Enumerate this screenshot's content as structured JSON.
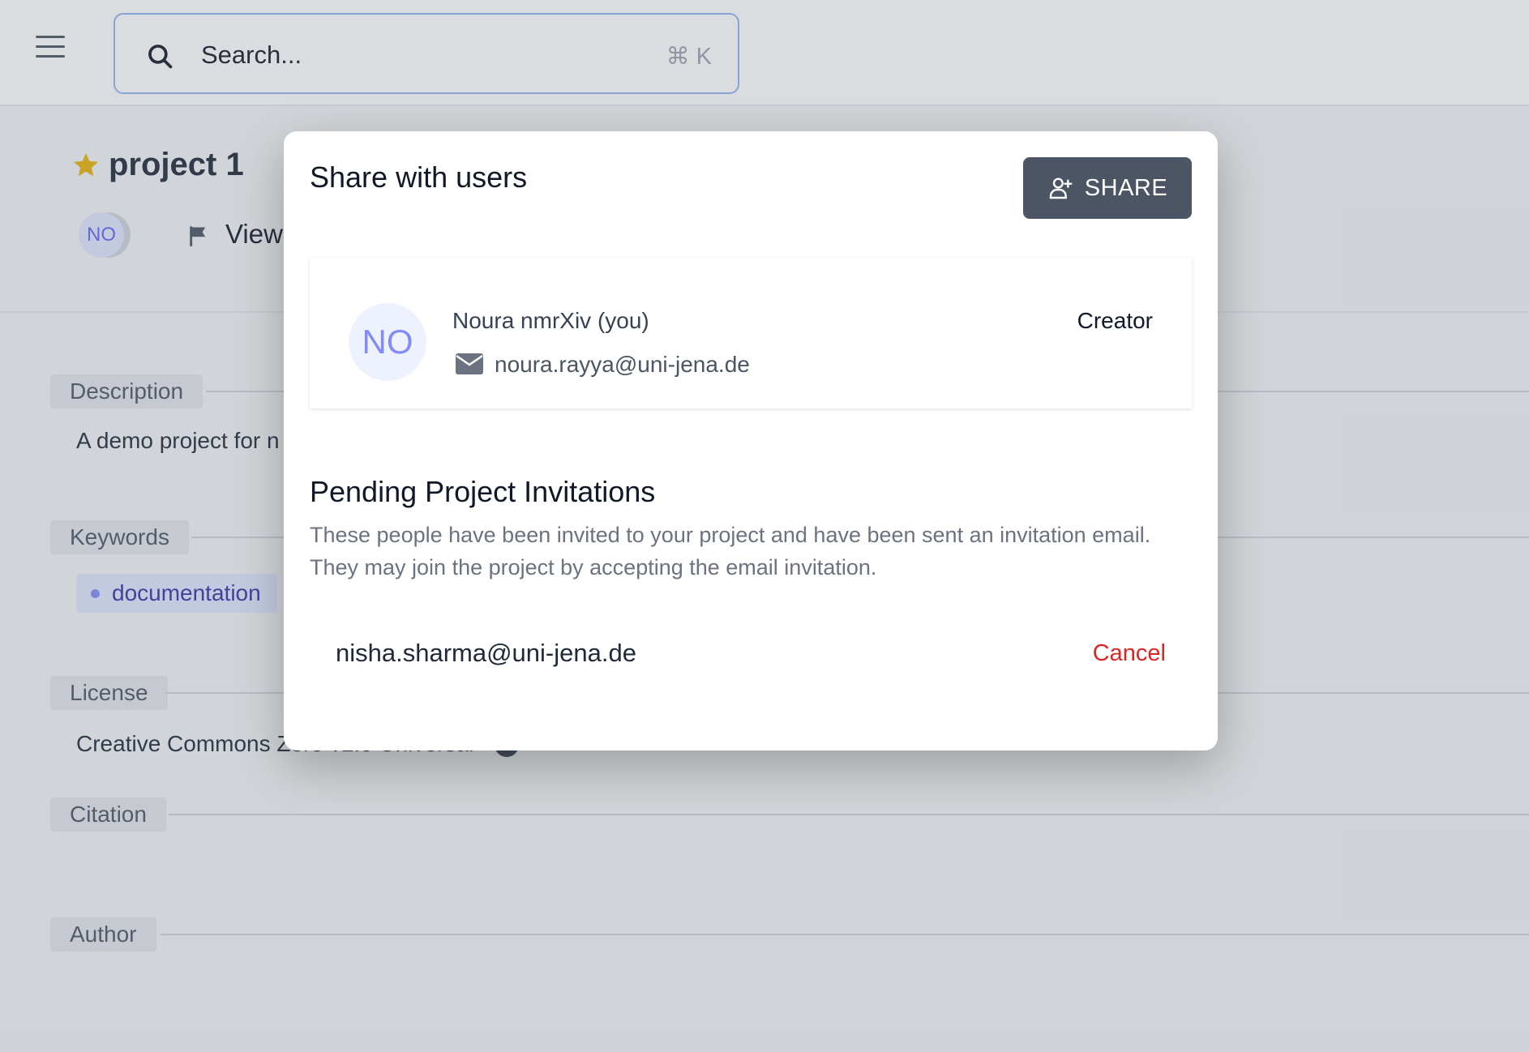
{
  "header": {
    "search_placeholder": "Search...",
    "search_shortcut": "⌘ K",
    "menu_icon": "hamburger-menu-icon",
    "search_icon": "search-icon"
  },
  "project": {
    "title": "project 1",
    "avatar_initials": "NO",
    "view_label": "View",
    "sections": {
      "description_label": "Description",
      "description_text": "A demo project for n",
      "keywords_label": "Keywords",
      "keyword": "documentation",
      "license_label": "License",
      "license_text": "Creative Commons Zero v1.0 Universal",
      "citation_label": "Citation",
      "author_label": "Author"
    }
  },
  "modal": {
    "title": "Share with users",
    "share_button": "SHARE",
    "user": {
      "initials": "NO",
      "name": "Noura nmrXiv (you)",
      "email": "noura.rayya@uni-jena.de",
      "role": "Creator"
    },
    "pending": {
      "title": "Pending Project Invitations",
      "description": "These people have been invited to your project and have been sent an invitation email. They may join the project by accepting the email invitation.",
      "invitations": [
        {
          "email": "nisha.sharma@uni-jena.de",
          "action": "Cancel"
        }
      ]
    }
  },
  "colors": {
    "accent_dark": "#4b5563",
    "danger": "#dc2626",
    "star": "#eab308",
    "search_border": "#93b4f0"
  }
}
